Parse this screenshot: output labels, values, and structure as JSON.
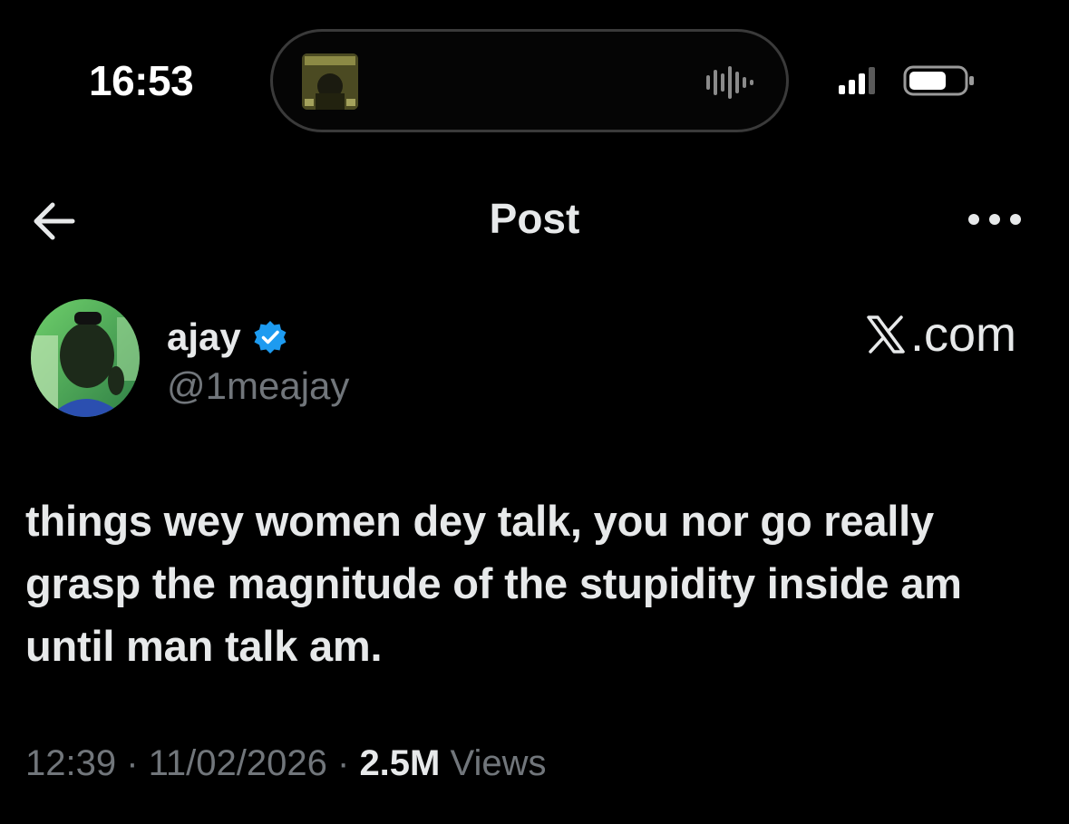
{
  "status_bar": {
    "time": "16:53"
  },
  "nav": {
    "title": "Post"
  },
  "author": {
    "name": "ajay",
    "handle": "@1meajay",
    "verified": true
  },
  "watermark": {
    "text": ".com"
  },
  "post": {
    "text": "things wey women dey talk, you nor go really grasp the magnitude of the stupidity inside am until man talk am."
  },
  "meta": {
    "time": "12:39",
    "separator": " · ",
    "date": "11/02/2026",
    "views_count": "2.5M",
    "views_label": " Views"
  },
  "colors": {
    "background": "#000000",
    "text_primary": "#e7e9ea",
    "text_secondary": "#71767b",
    "verified_blue": "#1d9bf0"
  },
  "icons": {
    "back": "arrow-left-icon",
    "more": "more-horizontal-icon",
    "verified": "verified-badge-icon",
    "signal": "cellular-signal-icon",
    "battery": "battery-icon",
    "waveform": "audio-waveform-icon"
  }
}
